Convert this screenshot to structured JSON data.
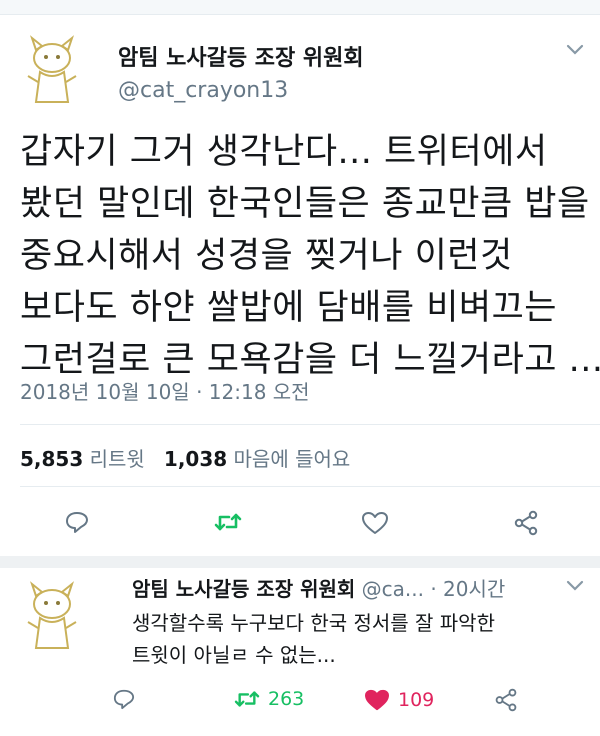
{
  "tweet": {
    "author_name": "암팀 노사갈등 조장 위원회",
    "author_handle": "@cat_crayon13",
    "text_lines": [
      "갑자기 그거 생각난다... 트위터에서",
      "봤던 말인데 한국인들은 종교만큼 밥을",
      "중요시해서 성경을 찢거나 이런것",
      "보다도 하얀 쌀밥에 담배를 비벼끄는",
      "그런걸로 큰 모욕감을 더 느낄거라고 ..."
    ],
    "timestamp": "2018년 10월 10일 · 12:18 오전",
    "retweet_count": "5,853",
    "retweet_label": "리트윗",
    "like_count": "1,038",
    "like_label": "마음에 들어요"
  },
  "reply": {
    "author_name": "암팀 노사갈등 조장 위원회",
    "author_handle_truncated": "@ca...",
    "time_ago": "· 20시간",
    "text_lines": [
      "생각할수록 누구보다 한국 정서를 잘 파악한",
      "트윗이 아닐ㄹ 수 없는..."
    ],
    "retweet_count": "263",
    "like_count": "109"
  },
  "icons": {
    "reply": "speech-bubble-icon",
    "retweet": "retweet-icon",
    "like": "heart-icon",
    "share": "share-icon",
    "caret": "chevron-down-icon"
  },
  "colors": {
    "retweet_green": "#17bf63",
    "like_red": "#e0245e",
    "icon_gray": "#657786"
  }
}
